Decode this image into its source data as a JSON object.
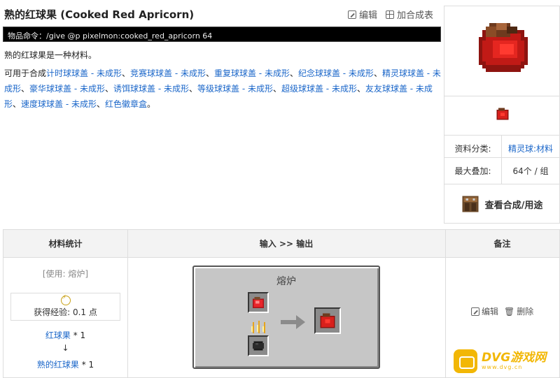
{
  "page": {
    "title": "熟的红球果 (Cooked Red Apricorn)",
    "edit_label": "编辑",
    "add_table_label": "加合成表",
    "command": "物品命令：/give @p pixelmon:cooked_red_apricorn 64",
    "description": "熟的红球果是一种材料。",
    "uses_prefix": "可用于合成",
    "uses": [
      "计时球球盖 - 未成形",
      "竞赛球球盖 - 未成形",
      "重复球球盖 - 未成形",
      "纪念球球盖 - 未成形",
      "精灵球球盖 - 未成形",
      "豪华球球盖 - 未成形",
      "诱饵球球盖 - 未成形",
      "等级球球盖 - 未成形",
      "超级球球盖 - 未成形",
      "友友球球盖 - 未成形",
      "速度球球盖 - 未成形",
      "红色徽章盒"
    ],
    "uses_separator": "、",
    "uses_suffix": "。"
  },
  "infobox": {
    "category_key": "资料分类:",
    "category_value": "精灵球:材料",
    "stack_key": "最大叠加:",
    "stack_value": "64个 / 组",
    "craft_button": "查看合成/用途"
  },
  "recipe_table": {
    "headers": [
      "材料统计",
      "输入 >> 输出",
      "备注"
    ],
    "usage": "[使用: 熔炉]",
    "xp": "获得经验:  0.1 点",
    "input_name": "红球果",
    "input_qty": " * 1",
    "arrow": "↓",
    "output_name": "熟的红球果",
    "output_qty": " * 1",
    "furnace_title": "熔炉",
    "note_edit": "编辑",
    "note_delete": "删除"
  },
  "watermark": {
    "brand": "DVG游戏网",
    "url": "www.dvg.cn"
  },
  "colors": {
    "link": "#1a66c9",
    "command_bg": "#000000",
    "apricorn_red": "#d8201c",
    "watermark": "#f2b705"
  }
}
